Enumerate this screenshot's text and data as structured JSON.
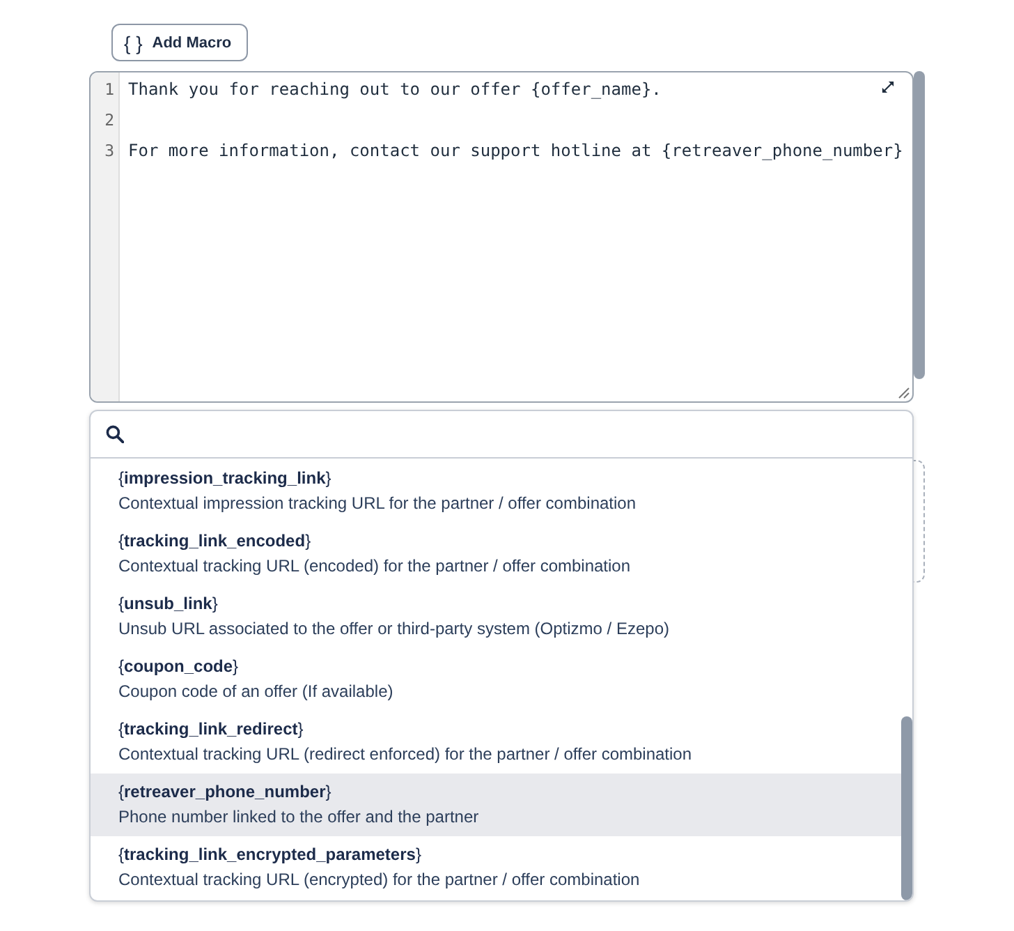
{
  "toolbar": {
    "add_macro_button": {
      "icon": "{ }",
      "label": "Add Macro"
    }
  },
  "editor": {
    "lines": [
      {
        "number": "1",
        "text": "Thank you for reaching out to our offer {offer_name}."
      },
      {
        "number": "2"
      },
      {
        "number": "3",
        "text": "For more information, contact our support hotline at {retreaver_phone_number}"
      }
    ]
  },
  "macro_picker": {
    "items": [
      {
        "name": "{**impression_tracking_link**}",
        "description": "Contextual impression tracking URL for the partner / offer combination",
        "selected": false
      },
      {
        "name": "{**tracking_link_encoded**}",
        "description": "Contextual tracking URL (encoded) for the partner / offer combination",
        "selected": false
      },
      {
        "name": "{**unsub_link**}",
        "description": "Unsub URL associated to the offer or third-party system (Optizmo / Ezepo)",
        "selected": false
      },
      {
        "name": "{**coupon_code**}",
        "description": "Coupon code of an offer (If available)",
        "selected": false
      },
      {
        "name": "{**tracking_link_redirect**}",
        "description": "Contextual tracking URL (redirect enforced) for the partner / offer combination",
        "selected": false
      },
      {
        "name": "{**retreaver_phone_number**}",
        "description": "Phone number linked to the offer and the partner",
        "selected": true
      },
      {
        "name": "{**tracking_link_encrypted_parameters**}",
        "description": "Contextual tracking URL (encrypted) for the partner / offer combination",
        "selected": false
      }
    ]
  }
}
